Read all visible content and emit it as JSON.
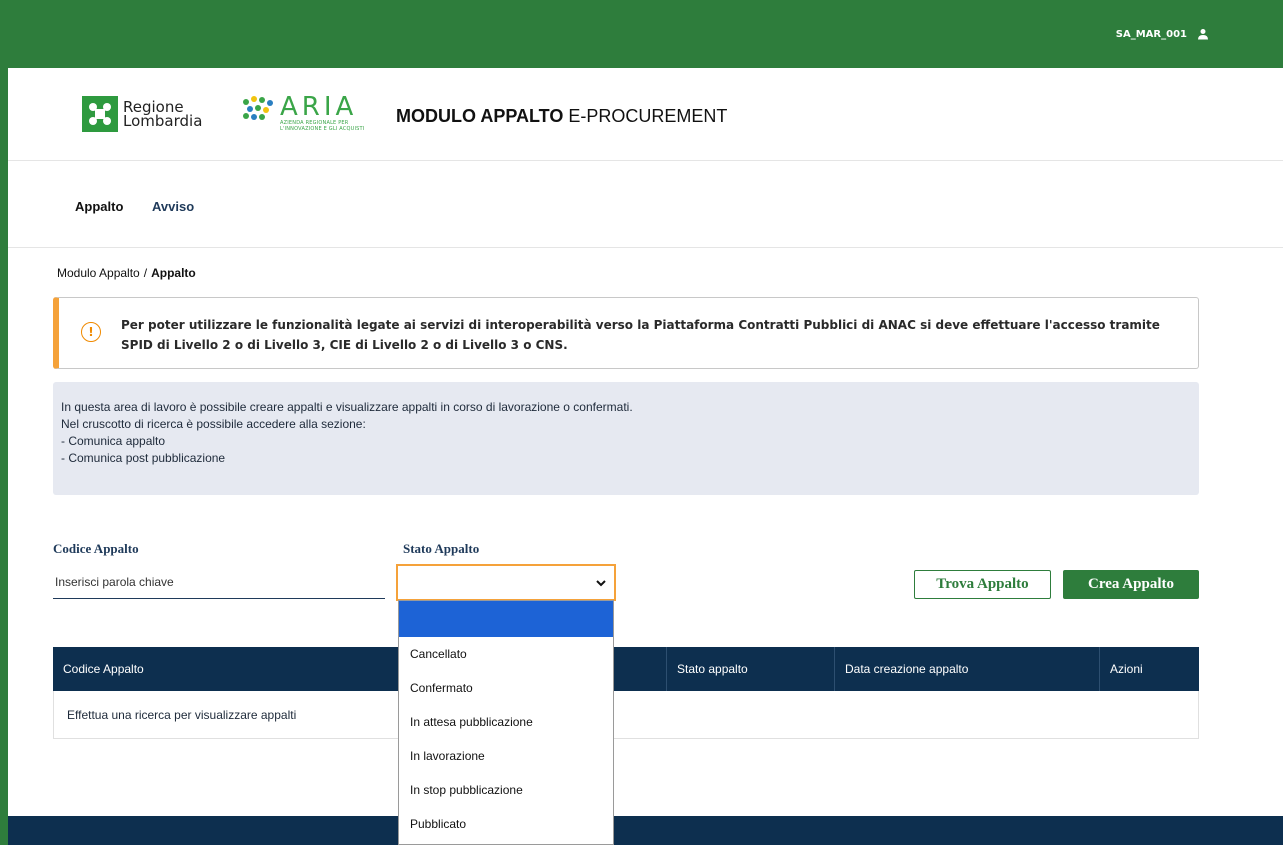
{
  "user": {
    "name": "SA_MAR_001"
  },
  "header": {
    "logo_regione_line1": "Regione",
    "logo_regione_line2": "Lombardia",
    "logo_aria_name": "ARIA",
    "logo_aria_sub1": "AZIENDA REGIONALE PER",
    "logo_aria_sub2": "L'INNOVAZIONE E GLI ACQUISTI",
    "title_bold": "MODULO APPALTO",
    "title_rest": " E-PROCUREMENT"
  },
  "nav": {
    "items": [
      {
        "label": "Appalto"
      },
      {
        "label": "Avviso"
      }
    ]
  },
  "breadcrumb": {
    "parent": "Modulo Appalto",
    "separator": "/",
    "current": "Appalto"
  },
  "warning": {
    "text": "Per poter utilizzare le funzionalità legate ai servizi di interoperabilità verso la Piattaforma Contratti Pubblici di ANAC si deve effettuare l'accesso tramite SPID di Livello 2 o di Livello 3, CIE di Livello 2 o di Livello 3 o CNS."
  },
  "info": {
    "lines": [
      "In questa area di lavoro è possibile creare appalti e visualizzare appalti in corso di lavorazione o confermati.",
      "Nel cruscotto di ricerca è possibile accedere alla sezione:",
      "- Comunica appalto",
      "- Comunica post pubblicazione"
    ]
  },
  "form": {
    "codice_label": "Codice Appalto",
    "codice_placeholder": "Inserisci parola chiave",
    "stato_label": "Stato Appalto",
    "stato_value": "",
    "stato_options": [
      "",
      "Cancellato",
      "Confermato",
      "In attesa pubblicazione",
      "In lavorazione",
      "In stop pubblicazione",
      "Pubblicato"
    ],
    "find_button": "Trova Appalto",
    "create_button": "Crea Appalto"
  },
  "table": {
    "columns": [
      "Codice Appalto",
      "Stato appalto",
      "Data creazione appalto",
      "Azioni"
    ],
    "empty_message": "Effettua una ricerca per visualizzare appalti"
  },
  "colors": {
    "brand_green": "#2e7d3c",
    "navy": "#0d2f4f",
    "warning_orange": "#f5a23a",
    "info_bg": "#e6e9f1",
    "selected_blue": "#1d63d6"
  }
}
